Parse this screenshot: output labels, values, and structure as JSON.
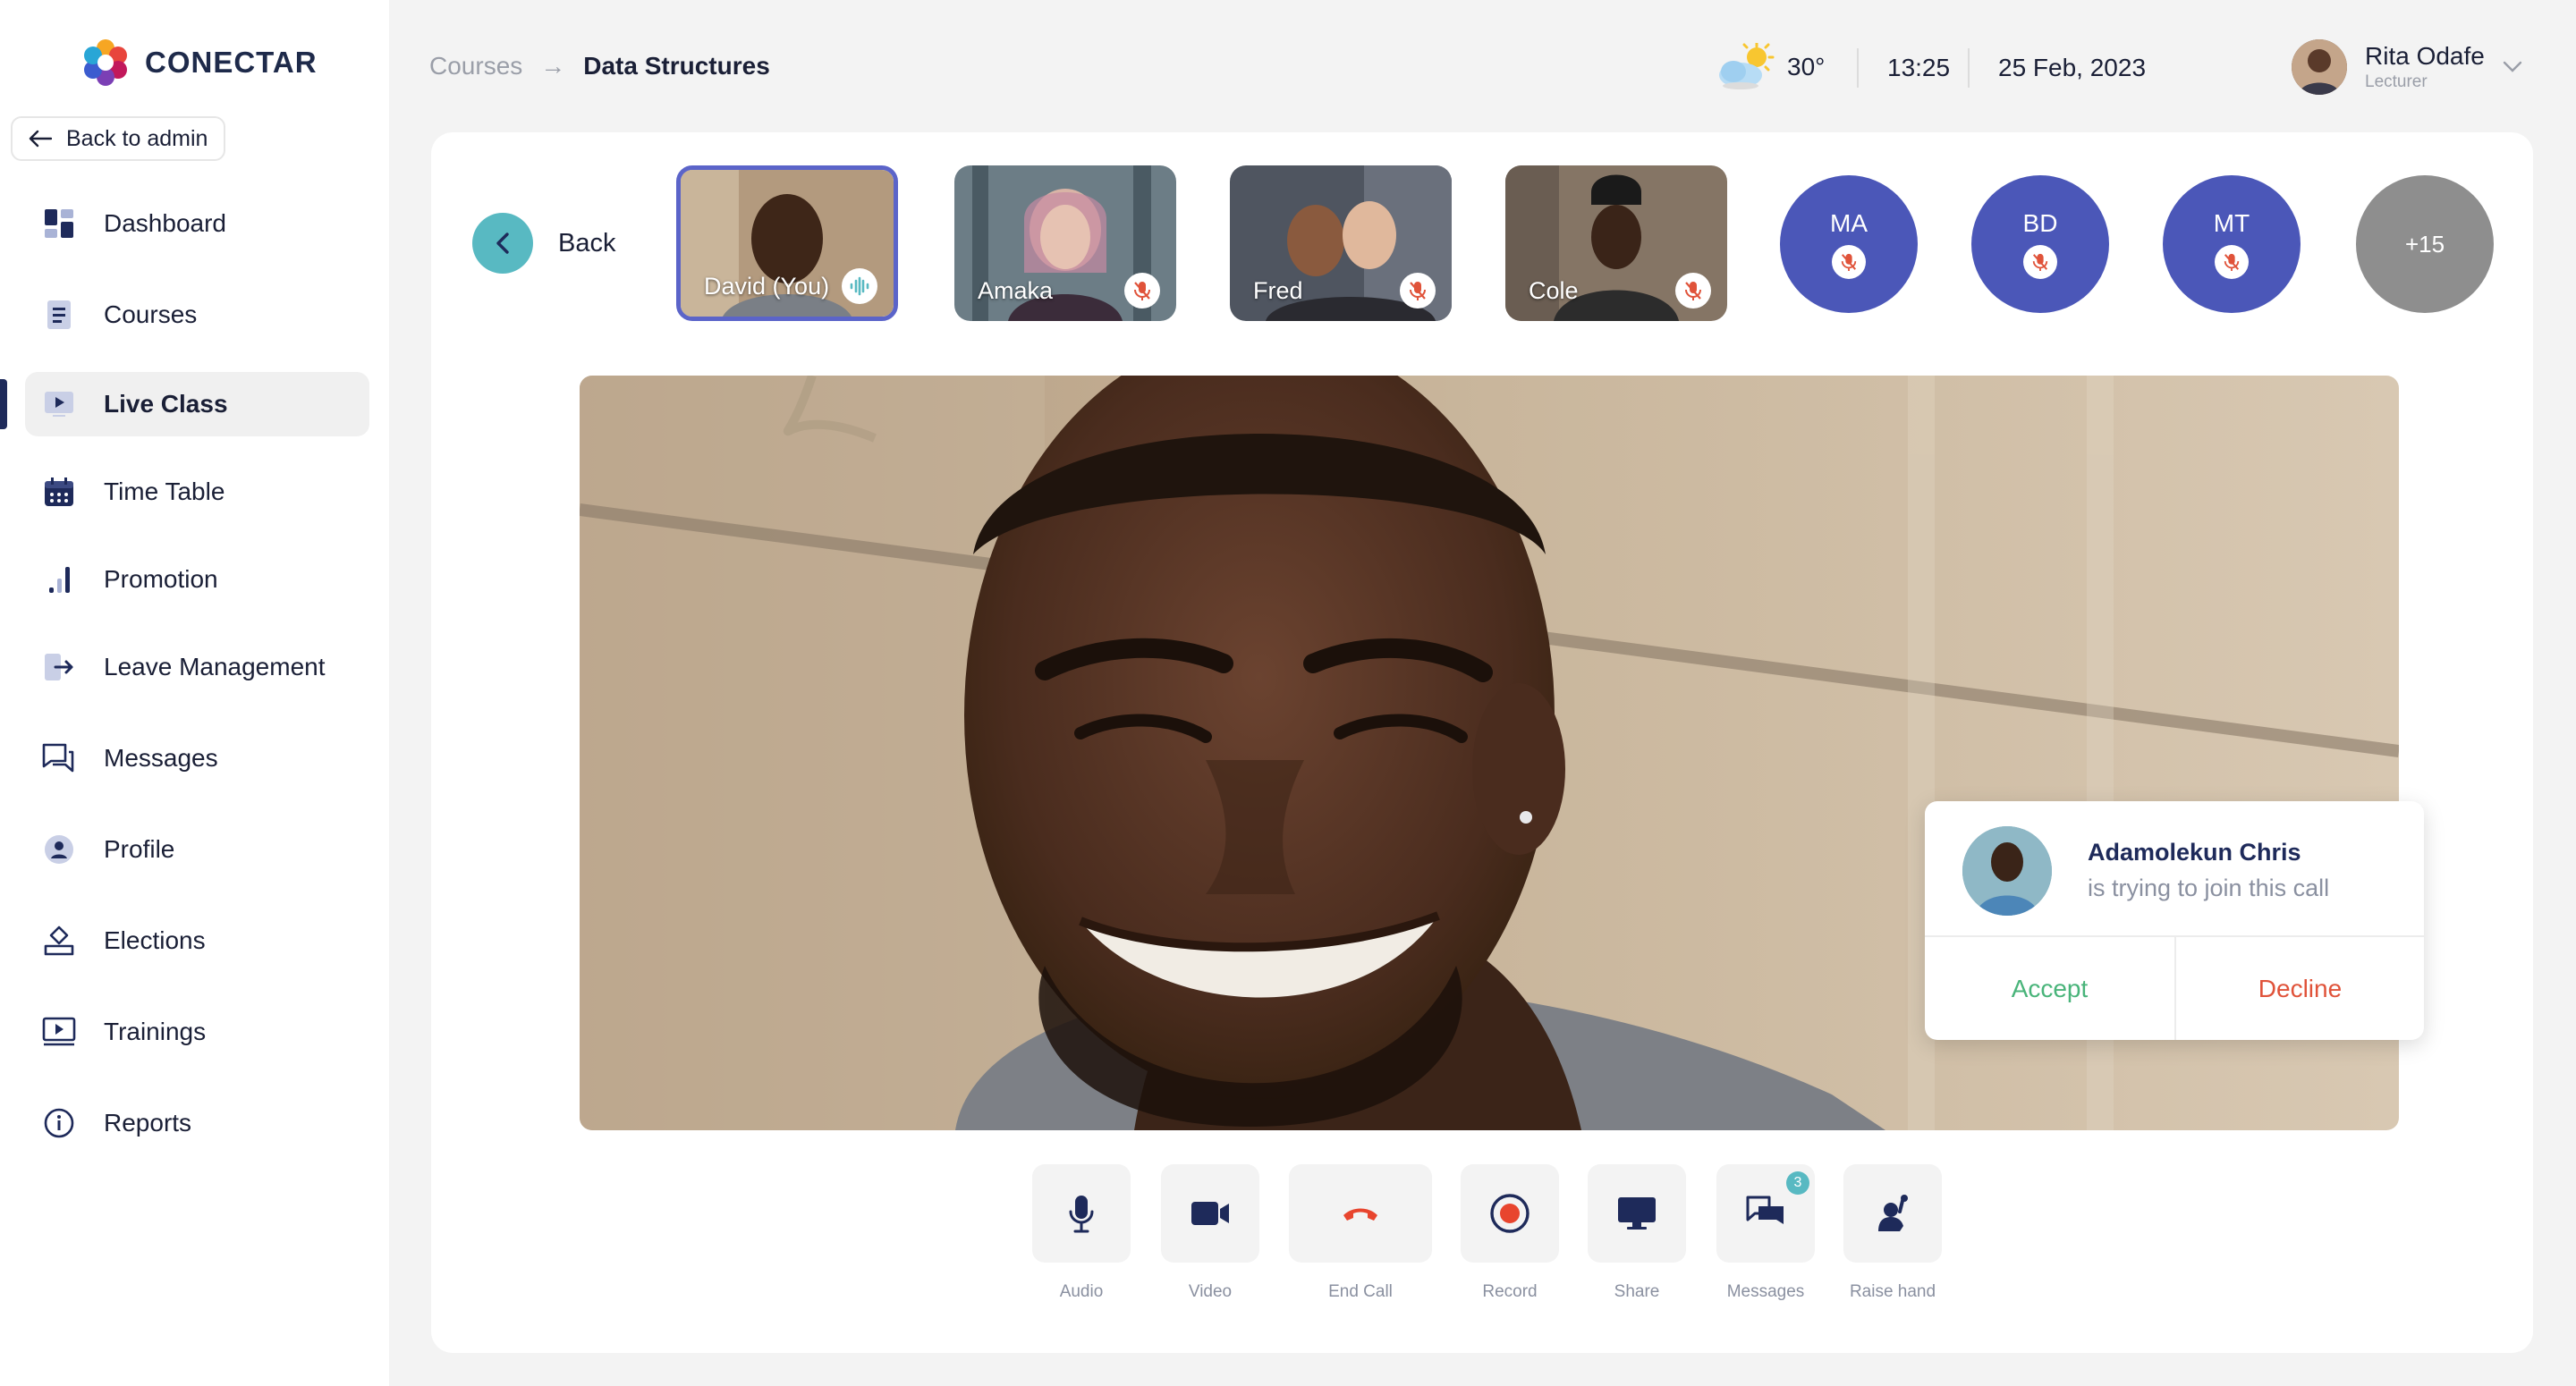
{
  "app": {
    "name": "CONECTAR"
  },
  "sidebar": {
    "back_label": "Back to admin",
    "items": [
      {
        "label": "Dashboard",
        "icon": "dashboard-icon"
      },
      {
        "label": "Courses",
        "icon": "courses-icon"
      },
      {
        "label": "Live Class",
        "icon": "live-class-icon",
        "active": true
      },
      {
        "label": "Time Table",
        "icon": "calendar-icon"
      },
      {
        "label": "Promotion",
        "icon": "bar-chart-icon"
      },
      {
        "label": "Leave Management",
        "icon": "exit-icon"
      },
      {
        "label": "Messages",
        "icon": "chat-icon"
      },
      {
        "label": "Profile",
        "icon": "user-icon"
      },
      {
        "label": "Elections",
        "icon": "ballot-icon"
      },
      {
        "label": "Trainings",
        "icon": "video-screen-icon"
      },
      {
        "label": "Reports",
        "icon": "info-icon"
      }
    ]
  },
  "header": {
    "breadcrumb": {
      "parent": "Courses",
      "separator": "→",
      "current": "Data Structures"
    },
    "weather": {
      "temp": "30°",
      "icon": "partly-sunny-icon"
    },
    "time": "13:25",
    "date": "25 Feb, 2023",
    "user": {
      "name": "Rita Odafe",
      "role": "Lecturer"
    }
  },
  "call": {
    "back_label": "Back",
    "participants": [
      {
        "name": "David (You)",
        "status": "speaking"
      },
      {
        "name": "Amaka",
        "status": "muted"
      },
      {
        "name": "Fred",
        "status": "muted"
      },
      {
        "name": "Cole",
        "status": "muted"
      }
    ],
    "initials": [
      "MA",
      "BD",
      "MT"
    ],
    "more_count": "+15",
    "join_request": {
      "name": "Adamolekun Chris",
      "message": "is trying to join this call",
      "accept": "Accept",
      "decline": "Decline"
    },
    "controls": {
      "audio": "Audio",
      "video": "Video",
      "end_call": "End Call",
      "record": "Record",
      "share": "Share",
      "messages": "Messages",
      "messages_badge": "3",
      "raise_hand": "Raise hand"
    }
  },
  "colors": {
    "accent": "#5b64c9",
    "teal": "#58b9c2",
    "accept": "#49b47a",
    "decline": "#e0533a",
    "navy": "#1e2a5a"
  }
}
